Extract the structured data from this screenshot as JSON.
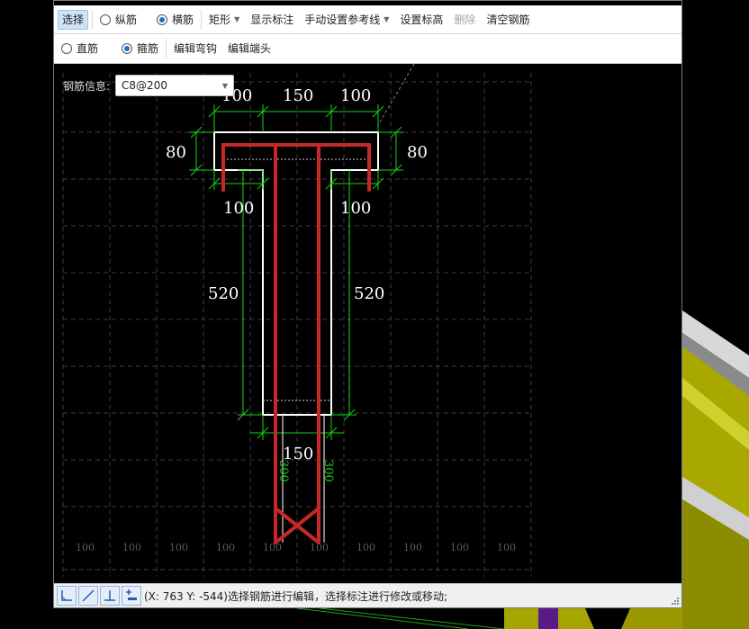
{
  "toolbar1": {
    "select_label": "选择",
    "longitudinal_label": "纵筋",
    "transverse_label": "横筋",
    "shape_label": "矩形",
    "show_dims_label": "显示标注",
    "manual_ref_label": "手动设置参考线",
    "set_elevation_label": "设置标高",
    "delete_label": "删除",
    "clear_rebar_label": "清空钢筋"
  },
  "toolbar2": {
    "straight_label": "直筋",
    "stirrup_label": "箍筋",
    "edit_hook_label": "编辑弯钩",
    "edit_end_label": "编辑端头"
  },
  "rebar_info": {
    "label": "钢筋信息:",
    "value": "C8@200"
  },
  "dimensions": {
    "top_left": "100",
    "top_mid": "150",
    "top_right": "100",
    "flange_left": "80",
    "flange_right": "80",
    "under_left": "100",
    "under_right": "100",
    "web_left": "520",
    "web_right": "520",
    "bottom_width": "150",
    "ext_left": "300",
    "ext_right": "300"
  },
  "grid_labels": [
    "100",
    "100",
    "100",
    "100",
    "100",
    "100",
    "100",
    "100",
    "100",
    "100"
  ],
  "status": {
    "text": "(X: 763 Y: -544)选择钢筋进行编辑，选择标注进行修改或移动;"
  },
  "colors": {
    "rebar": "#c62828",
    "dimension": "#18d418",
    "outline": "#ffffff",
    "grid": "#3a3a48",
    "model_yellow": "#b8b800"
  }
}
